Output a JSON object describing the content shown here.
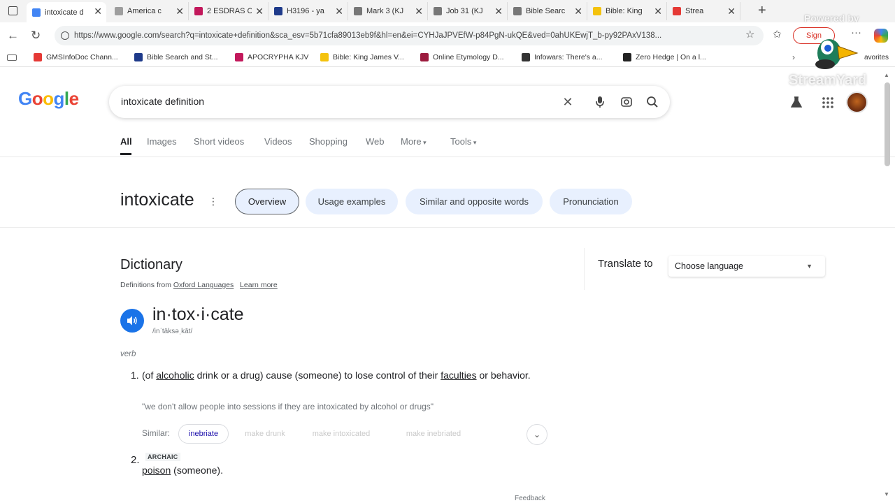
{
  "browser": {
    "tabs": [
      {
        "title": "intoxicate d",
        "active": true,
        "favicon_color": "#4285f4"
      },
      {
        "title": "America c",
        "active": false,
        "favicon_color": "#9e9e9e"
      },
      {
        "title": "2 ESDRAS C",
        "active": false,
        "favicon_color": "#c2185b"
      },
      {
        "title": "H3196 - ya",
        "active": false,
        "favicon_color": "#1e3a8a"
      },
      {
        "title": "Mark 3 (KJ",
        "active": false,
        "favicon_color": "#777777"
      },
      {
        "title": "Job 31 (KJ",
        "active": false,
        "favicon_color": "#777777"
      },
      {
        "title": "Bible Searc",
        "active": false,
        "favicon_color": "#777777"
      },
      {
        "title": "Bible: King",
        "active": false,
        "favicon_color": "#f4c20d"
      },
      {
        "title": "Strea",
        "active": false,
        "favicon_color": "#e53935"
      }
    ],
    "url": "https://www.google.com/search?q=intoxicate+definition&sca_esv=5b71cfa89013eb9f&hl=en&ei=CYHJaJPVEfW-p84PgN-ukQE&ved=0ahUKEwjT_b-py92PAxV138...",
    "sign_in_label": "Sign",
    "favorites_label": "avorites",
    "bookmarks": [
      {
        "label": "GMSInfoDoc Chann...",
        "color": "#e53935"
      },
      {
        "label": "Bible Search and St...",
        "color": "#1e3a8a"
      },
      {
        "label": "APOCRYPHA KJV",
        "color": "#c2185b"
      },
      {
        "label": "Bible: King James V...",
        "color": "#f4c20d"
      },
      {
        "label": "Online Etymology D...",
        "color": "#9c1b3e"
      },
      {
        "label": "Infowars: There's a...",
        "color": "#333333"
      },
      {
        "label": "Zero Hedge | On a l...",
        "color": "#222222"
      }
    ]
  },
  "overlay": {
    "powered_by": "Powered by",
    "brand": "StreamYard"
  },
  "google": {
    "logo": [
      "G",
      "o",
      "o",
      "g",
      "l",
      "e"
    ],
    "logo_colors": [
      "#4285f4",
      "#ea4335",
      "#fbbc05",
      "#4285f4",
      "#34a853",
      "#ea4335"
    ],
    "query": "intoxicate definition",
    "filters": [
      "All",
      "Images",
      "Short videos",
      "Videos",
      "Shopping",
      "Web",
      "More",
      "Tools"
    ],
    "active_filter": "All"
  },
  "word_header": {
    "word": "intoxicate",
    "chips": [
      "Overview",
      "Usage examples",
      "Similar and opposite words",
      "Pronunciation"
    ],
    "selected_chip": "Overview"
  },
  "dictionary": {
    "title": "Dictionary",
    "source_prefix": "Definitions from",
    "source_link": "Oxford Languages",
    "learn_more": "Learn more",
    "syllables": "in·tox·i·cate",
    "ipa": "/inˈtäksəˌkāt/",
    "part_of_speech": "verb",
    "definitions": [
      {
        "num": "1.",
        "parts": [
          "(of ",
          "alcoholic",
          " drink or a drug) cause (someone) to lose control of their ",
          "faculties",
          " or behavior."
        ],
        "example": "\"we don't allow people into sessions if they are intoxicated by alcohol or drugs\"",
        "similar_label": "Similar:",
        "similar": [
          "inebriate",
          "make drunk",
          "make intoxicated",
          "make inebriated"
        ]
      },
      {
        "num": "2.",
        "label": "ARCHAIC",
        "parts": [
          "poison",
          " (someone)."
        ]
      }
    ],
    "feedback": "Feedback"
  },
  "translate": {
    "label": "Translate to",
    "placeholder": "Choose language"
  }
}
